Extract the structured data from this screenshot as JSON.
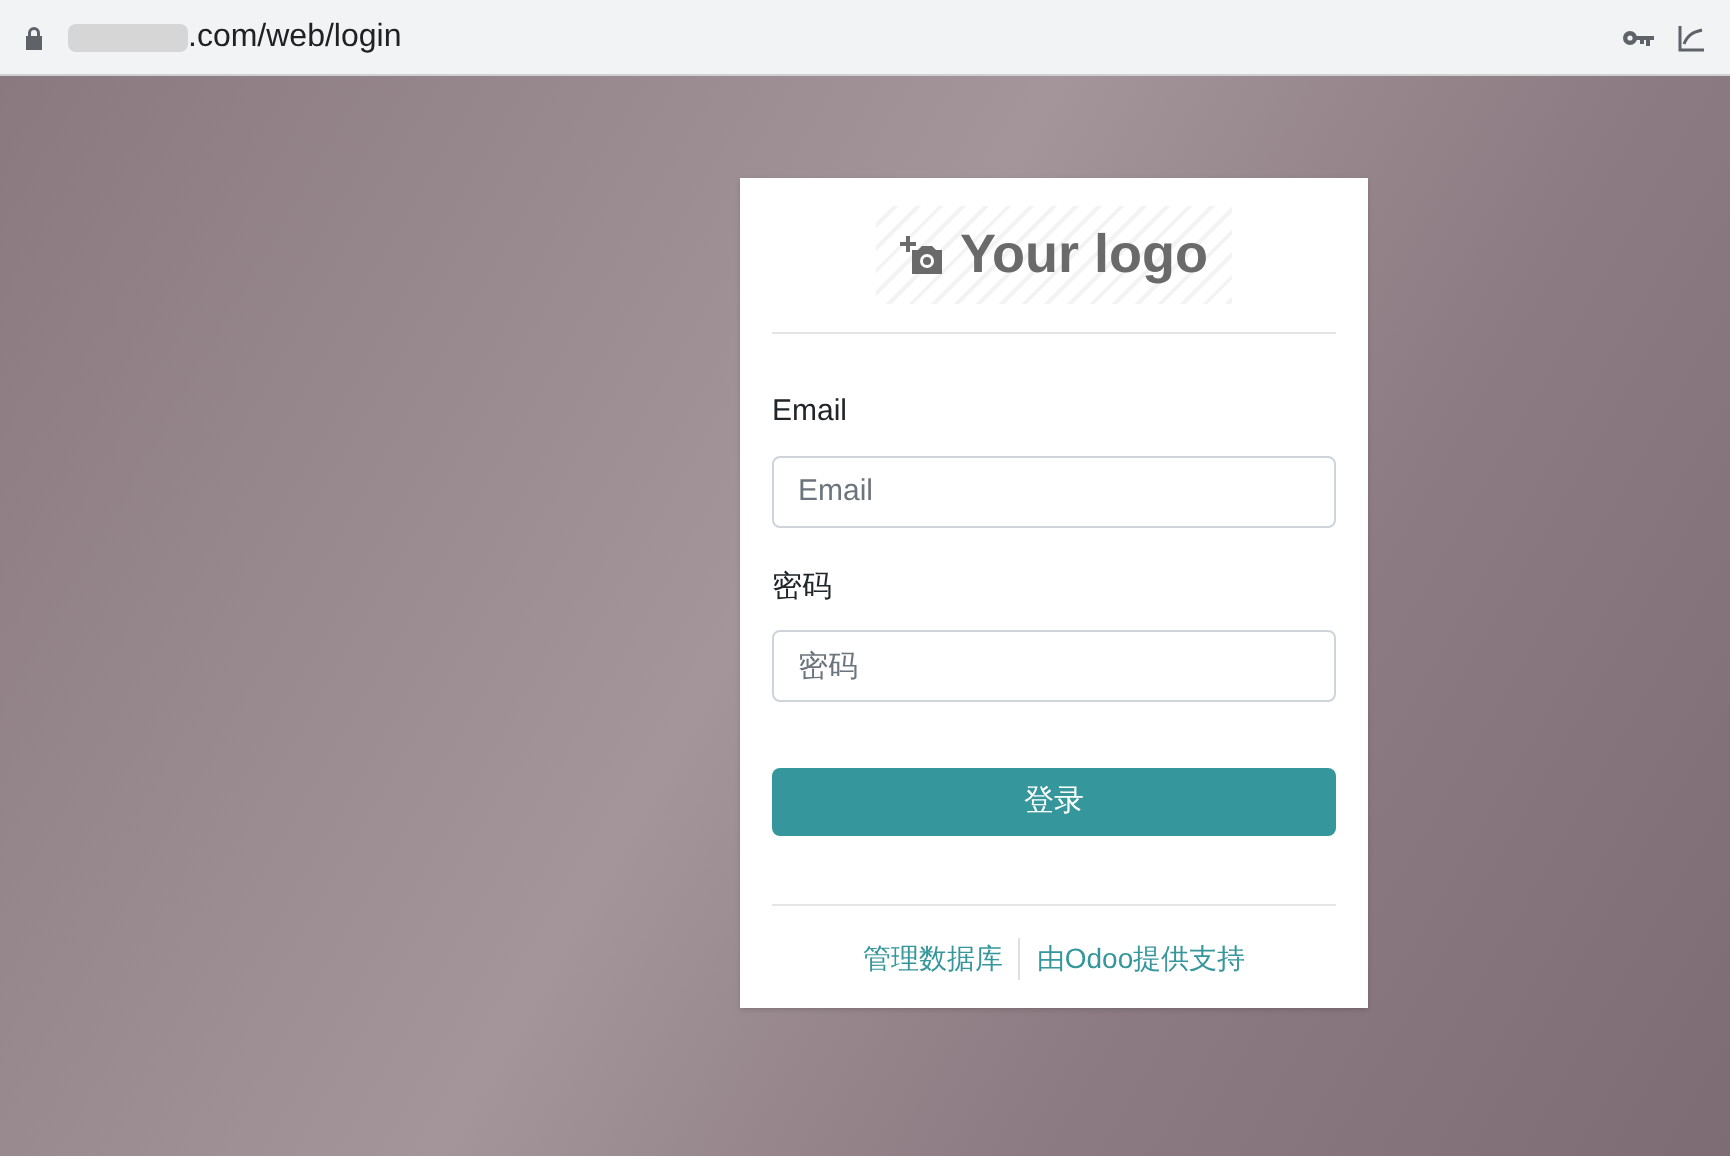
{
  "browser": {
    "url": ".com/web/login"
  },
  "logo": {
    "text": "Your logo"
  },
  "form": {
    "fields": [
      {
        "label": "Email",
        "placeholder": "Email"
      },
      {
        "label": "密码",
        "placeholder": "密码"
      }
    ],
    "submit": "登录"
  },
  "footer_links": [
    "管理数据库",
    "由Odoo提供支持"
  ]
}
